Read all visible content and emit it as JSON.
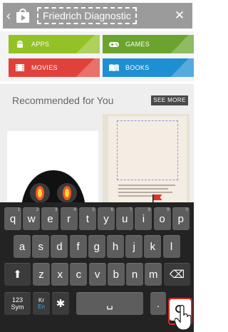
{
  "topbar": {
    "back_glyph": "‹",
    "store_icon": "play-store-icon",
    "search_value": "Friedrich Diagnostic",
    "clear_glyph": "✕"
  },
  "categories": [
    {
      "label": "APPS",
      "icon": "android-icon",
      "color": "#94c126"
    },
    {
      "label": "GAMES",
      "icon": "gamepad-icon",
      "color": "#6aa42e"
    },
    {
      "label": "MOVIES",
      "icon": "film-icon",
      "color": "#e0423b"
    },
    {
      "label": "BOOKS",
      "icon": "book-icon",
      "color": "#1e8fd2"
    }
  ],
  "recommended": {
    "title": "Recommended for You",
    "see_more": "SEE MORE"
  },
  "keyboard": {
    "row1": [
      {
        "key": "q",
        "hint": "1"
      },
      {
        "key": "w",
        "hint": "2"
      },
      {
        "key": "e",
        "hint": "3"
      },
      {
        "key": "r",
        "hint": "4"
      },
      {
        "key": "t",
        "hint": "5"
      },
      {
        "key": "y",
        "hint": "6"
      },
      {
        "key": "u",
        "hint": "7"
      },
      {
        "key": "i",
        "hint": "8"
      },
      {
        "key": "o",
        "hint": "9"
      },
      {
        "key": "p",
        "hint": "0"
      }
    ],
    "row2": [
      "a",
      "s",
      "d",
      "f",
      "g",
      "h",
      "j",
      "k",
      "l"
    ],
    "row3": [
      "z",
      "x",
      "c",
      "v",
      "b",
      "n",
      "m"
    ],
    "shift_glyph": "⬆",
    "backspace_glyph": "⌫",
    "sym_label": "123\nSym",
    "lang_top": "Kr",
    "lang_bottom": "En",
    "settings_glyph": "✱",
    "space_glyph": "␣",
    "period": ".",
    "search_icon": "search-icon"
  }
}
